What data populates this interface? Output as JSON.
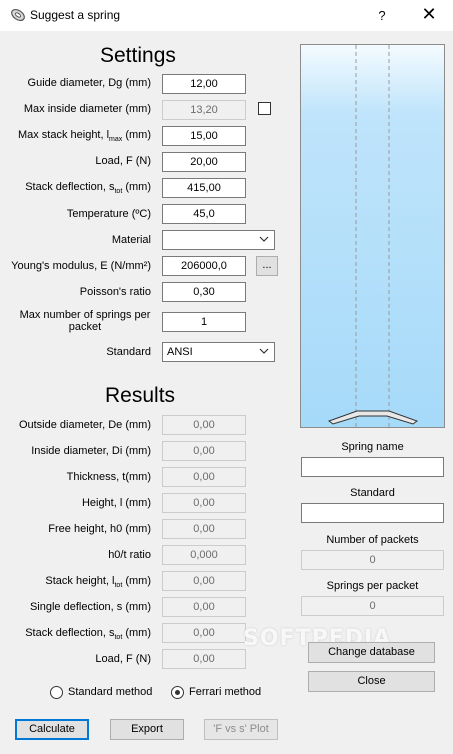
{
  "window": {
    "title": "Suggest a spring",
    "help_label": "?",
    "close_label": "✕"
  },
  "settings": {
    "heading": "Settings",
    "guide_diameter": {
      "label": "Guide diameter, Dg (mm)",
      "value": "12,00"
    },
    "max_inside_diameter": {
      "label": "Max inside diameter (mm)",
      "value": "13,20",
      "checked": false
    },
    "max_stack_height": {
      "label": "Max stack height, lmax (mm)",
      "value": "15,00"
    },
    "load": {
      "label": "Load, F (N)",
      "value": "20,00"
    },
    "stack_deflection": {
      "label": "Stack deflection, stot (mm)",
      "value": "415,00"
    },
    "temperature": {
      "label": "Temperature (ºC)",
      "value": "45,0"
    },
    "material": {
      "label": "Material",
      "value": ""
    },
    "youngs_modulus": {
      "label": "Young's modulus, E (N/mm²)",
      "value": "206000,0",
      "browse_label": "..."
    },
    "poissons_ratio": {
      "label": "Poisson's ratio",
      "value": "0,30"
    },
    "max_springs_per_packet": {
      "label": "Max number of springs per packet",
      "value": "1"
    },
    "standard": {
      "label": "Standard",
      "value": "ANSI"
    }
  },
  "results": {
    "heading": "Results",
    "rows": [
      {
        "label": "Outside diameter, De (mm)",
        "value": "0,00"
      },
      {
        "label": "Inside diameter, Di (mm)",
        "value": "0,00"
      },
      {
        "label": "Thickness, t(mm)",
        "value": "0,00"
      },
      {
        "label": "Height, l (mm)",
        "value": "0,00"
      },
      {
        "label": "Free height, h0 (mm)",
        "value": "0,00"
      },
      {
        "label": "h0/t ratio",
        "value": "0,000"
      },
      {
        "label": "Stack height, ltot (mm)",
        "value": "0,00"
      },
      {
        "label": "Single deflection, s (mm)",
        "value": "0,00"
      },
      {
        "label": "Stack deflection, stot (mm)",
        "value": "0,00"
      },
      {
        "label": "Load, F (N)",
        "value": "0,00"
      }
    ]
  },
  "methods": {
    "standard_label": "Standard method",
    "ferrari_label": "Ferrari method",
    "selected": "ferrari"
  },
  "buttons": {
    "calculate": "Calculate",
    "export": "Export",
    "plot": "'F vs s' Plot",
    "change_database": "Change database",
    "close": "Close"
  },
  "side": {
    "spring_name": {
      "label": "Spring name",
      "value": ""
    },
    "standard": {
      "label": "Standard",
      "value": ""
    },
    "packets": {
      "label": "Number of packets",
      "value": "0"
    },
    "springs_per_packet": {
      "label": "Springs per packet",
      "value": "0"
    }
  },
  "watermark": "SOFTPEDIA",
  "colors": {
    "accent": "#0078d7",
    "preview_fill": "#a6daf9",
    "spring_fill": "#e8e8e8"
  }
}
